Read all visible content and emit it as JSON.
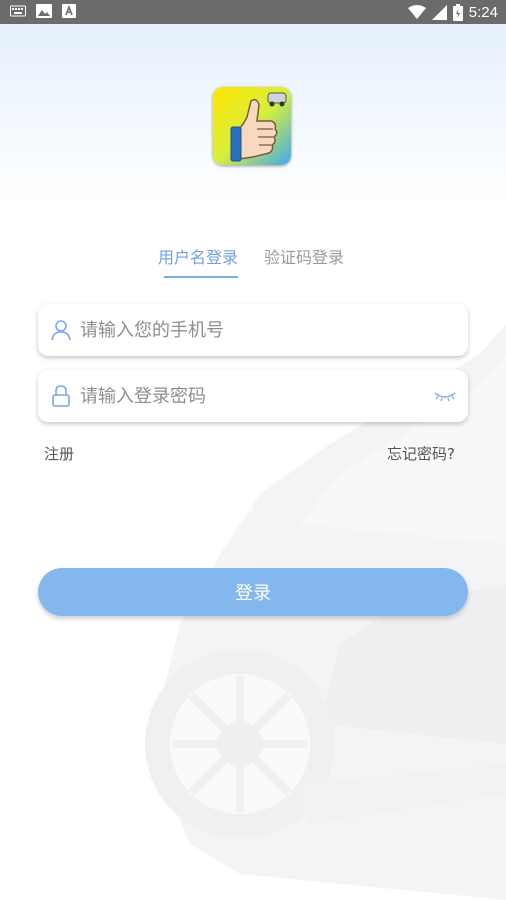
{
  "status_bar": {
    "time": "5:24",
    "icons": [
      "keyboard-icon",
      "image-icon",
      "text-a-icon",
      "wifi-icon",
      "signal-icon",
      "battery-icon"
    ]
  },
  "tabs": [
    {
      "label": "用户名登录",
      "active": true
    },
    {
      "label": "验证码登录",
      "active": false
    }
  ],
  "phone_input": {
    "placeholder": "请输入您的手机号",
    "value": ""
  },
  "password_input": {
    "placeholder": "请输入登录密码",
    "value": ""
  },
  "links": {
    "register": "注册",
    "forgot": "忘记密码?"
  },
  "login_button": {
    "label": "登录"
  },
  "colors": {
    "accent": "#6fa3dd",
    "button": "#85b7ef",
    "status_bar": "#6b6b6b",
    "tab_inactive": "#9a9a9a"
  }
}
